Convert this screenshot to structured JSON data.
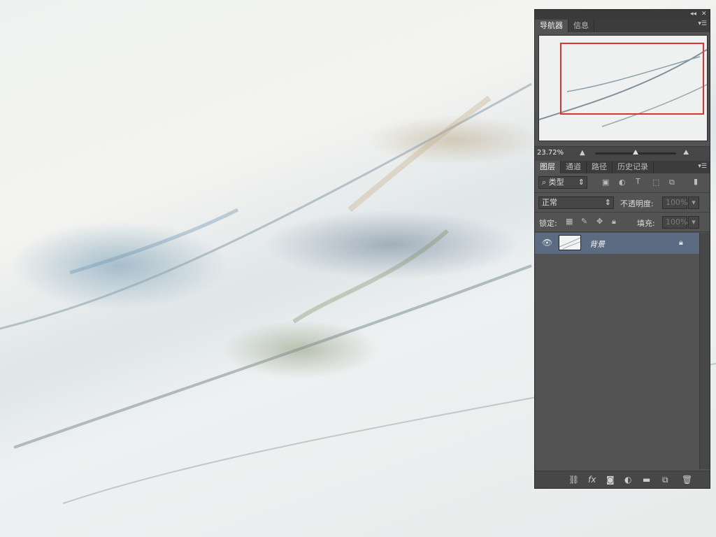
{
  "navigator_tabs": [
    "导航器",
    "信息"
  ],
  "navigator": {
    "zoom": "23.72%",
    "zoom_level": 0.5
  },
  "layers_tabs": [
    "图层",
    "通道",
    "路径",
    "历史记录"
  ],
  "filter": {
    "label": "类型"
  },
  "blend": {
    "mode": "正常",
    "opacity_label": "不透明度:",
    "opacity_value": "100%"
  },
  "lock": {
    "label": "锁定:",
    "fill_label": "填充:",
    "fill_value": "100%"
  },
  "layers": [
    {
      "name": "背景",
      "visible": true,
      "locked": true
    }
  ],
  "footer_icons": [
    "link-icon",
    "fx-icon",
    "mask-icon",
    "adjustment-icon",
    "folder-icon",
    "new-layer-icon",
    "trash-icon"
  ],
  "colors": {
    "panel_bg": "#535353",
    "selected_layer": "#5c6b82",
    "nav_rect": "#e03030"
  }
}
